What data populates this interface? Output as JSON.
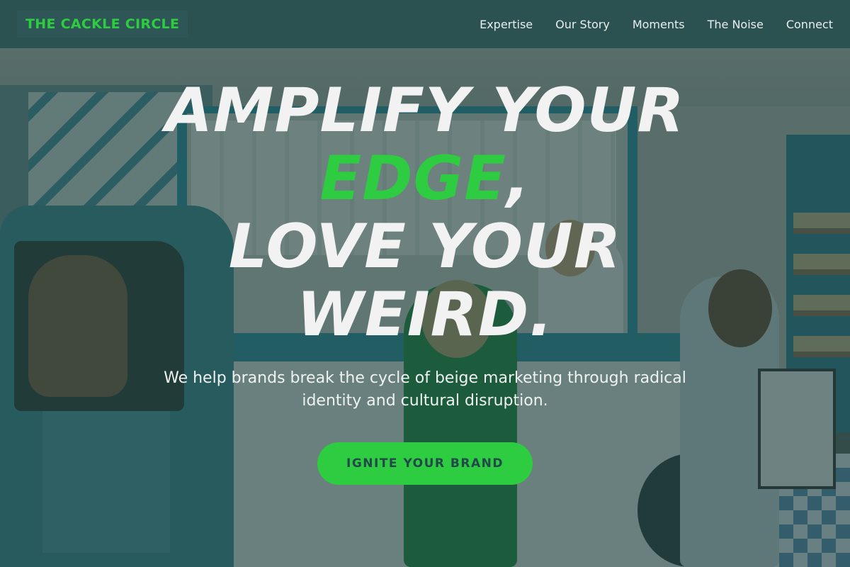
{
  "brand": {
    "name": "THE CACKLE CIRCLE",
    "accent_color": "#2ecc40"
  },
  "nav": {
    "items": [
      {
        "label": "Expertise"
      },
      {
        "label": "Our Story"
      },
      {
        "label": "Moments"
      },
      {
        "label": "The Noise"
      },
      {
        "label": "Connect"
      }
    ]
  },
  "hero": {
    "headline_line1": "AMPLIFY YOUR",
    "headline_accent": "EDGE",
    "headline_comma": ",",
    "headline_line3": "LOVE YOUR",
    "headline_line4": "WEIRD.",
    "subtitle": "We help brands break the cycle of beige marketing through radical identity and cultural disruption.",
    "cta_label": "IGNITE YOUR BRAND",
    "background_image": "shop-interior-photo"
  }
}
